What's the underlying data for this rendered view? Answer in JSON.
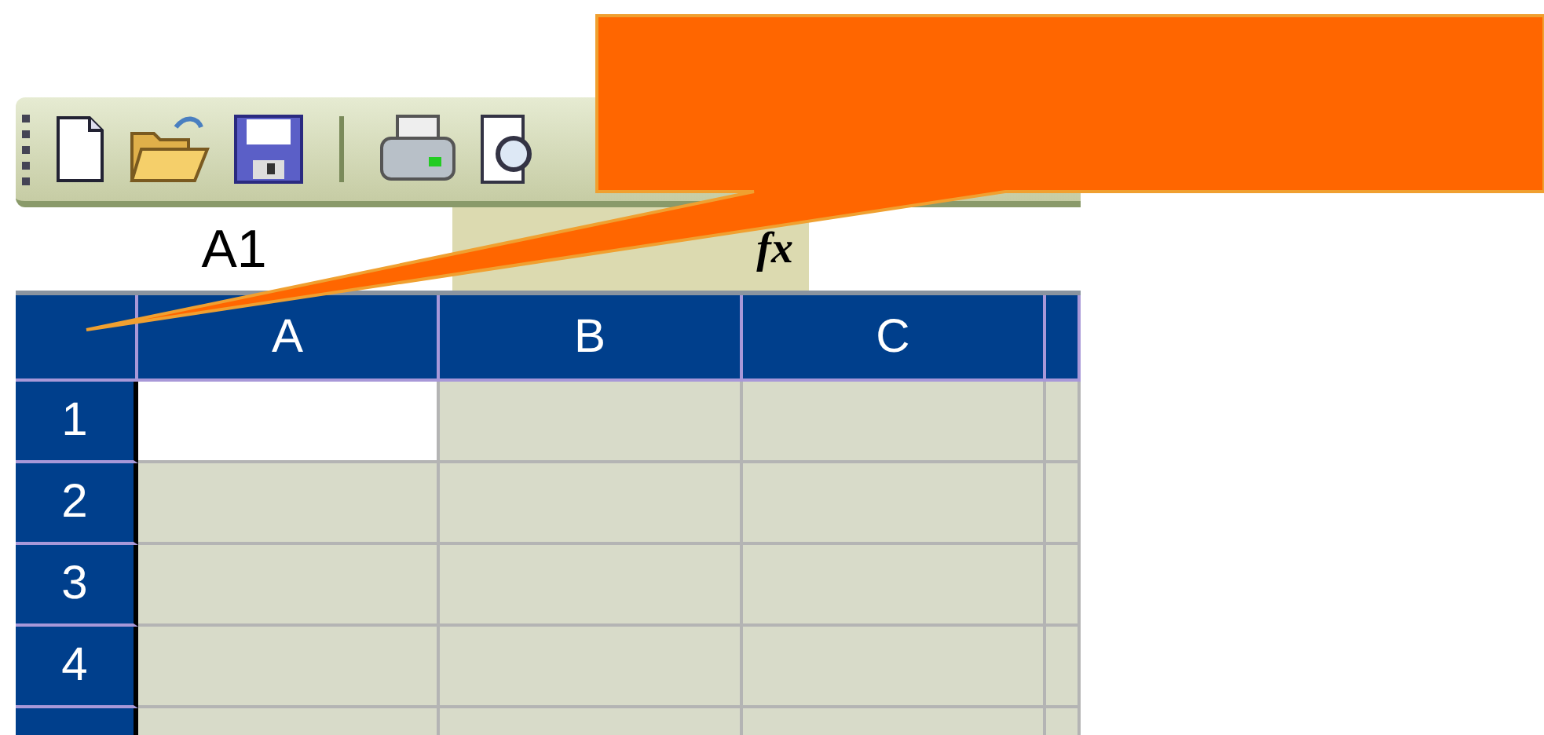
{
  "toolbar": {
    "buttons": [
      {
        "kind": "new"
      },
      {
        "kind": "open"
      },
      {
        "kind": "save"
      },
      {
        "kind": "separator"
      },
      {
        "kind": "print"
      },
      {
        "kind": "preview"
      }
    ]
  },
  "formula_bar": {
    "name_box": "A1",
    "function_label": "fx"
  },
  "grid": {
    "columns": [
      {
        "label": "A"
      },
      {
        "label": "B"
      },
      {
        "label": "C"
      }
    ],
    "rows": [
      {
        "label": "1",
        "cells": [
          {
            "selected": true
          },
          {
            "selected": false
          },
          {
            "selected": false
          },
          {
            "selected": false
          }
        ]
      },
      {
        "label": "2",
        "cells": [
          {
            "selected": false
          },
          {
            "selected": false
          },
          {
            "selected": false
          },
          {
            "selected": false
          }
        ]
      },
      {
        "label": "3",
        "cells": [
          {
            "selected": false
          },
          {
            "selected": false
          },
          {
            "selected": false
          },
          {
            "selected": false
          }
        ]
      },
      {
        "label": "4",
        "cells": [
          {
            "selected": false
          },
          {
            "selected": false
          },
          {
            "selected": false
          },
          {
            "selected": false
          }
        ]
      },
      {
        "cells": [
          {
            "selected": false
          },
          {
            "selected": false
          },
          {
            "selected": false
          },
          {
            "selected": false
          }
        ]
      }
    ]
  },
  "callout": {
    "color": "#ff6600"
  }
}
